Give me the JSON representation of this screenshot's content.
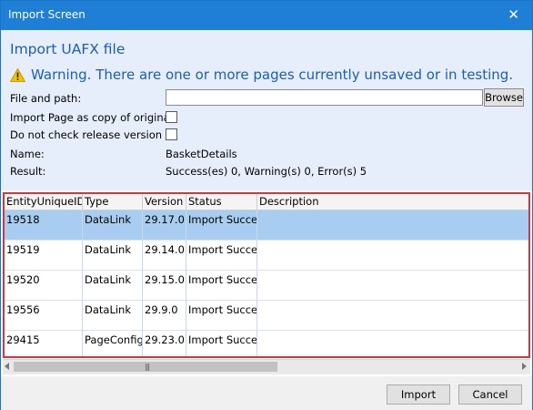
{
  "window": {
    "title": "Import Screen",
    "close_glyph": "✕"
  },
  "header": {
    "title": "Import UAFX file",
    "warning_icon": "warning-triangle-icon",
    "warning_text": "Warning. There are one or more pages currently unsaved or in testing."
  },
  "form": {
    "file_label": "File and path:",
    "file_value": "",
    "file_placeholder": "",
    "browse_label": "Browse",
    "copy_label": "Import Page as copy of original",
    "copy_checked": false,
    "release_label": "Do not check release version",
    "release_checked": false,
    "name_label": "Name:",
    "name_value": "BasketDetails",
    "result_label": "Result:",
    "result_value": "Success(es) 0, Warning(s) 0, Error(s) 5"
  },
  "grid": {
    "columns": [
      "EntityUniqueID",
      "Type",
      "Version",
      "Status",
      "Description"
    ],
    "rows": [
      {
        "id": "19518",
        "type": "DataLink",
        "version": "29.17.0",
        "status": "Import Success",
        "description": "",
        "selected": true
      },
      {
        "id": "19519",
        "type": "DataLink",
        "version": "29.14.0",
        "status": "Import Success",
        "description": "",
        "selected": false
      },
      {
        "id": "19520",
        "type": "DataLink",
        "version": "29.15.0",
        "status": "Import Success",
        "description": "",
        "selected": false
      },
      {
        "id": "19556",
        "type": "DataLink",
        "version": "29.9.0",
        "status": "Import Success",
        "description": "",
        "selected": false
      },
      {
        "id": "29415",
        "type": "PageConfig",
        "version": "29.23.0",
        "status": "Import Success",
        "description": "",
        "selected": false
      }
    ]
  },
  "buttons": {
    "import": "Import",
    "cancel": "Cancel"
  },
  "colors": {
    "titlebar": "#1f7fd6",
    "accent_text": "#1d5eb3",
    "highlight_border": "#e0303a",
    "selected_row": "#a8cdf0"
  }
}
